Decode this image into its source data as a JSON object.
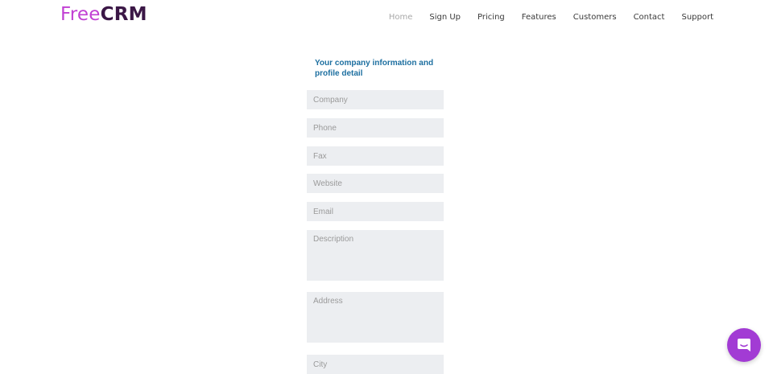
{
  "brand": {
    "part1": "Free",
    "part2": "CRM"
  },
  "nav": [
    {
      "label": "Home",
      "active": true
    },
    {
      "label": "Sign Up"
    },
    {
      "label": "Pricing"
    },
    {
      "label": "Features"
    },
    {
      "label": "Customers"
    },
    {
      "label": "Contact"
    },
    {
      "label": "Support"
    }
  ],
  "form": {
    "heading": "Your company information and profile detail",
    "company": {
      "placeholder": "Company",
      "value": ""
    },
    "phone": {
      "placeholder": "Phone",
      "value": ""
    },
    "fax": {
      "placeholder": "Fax",
      "value": ""
    },
    "website": {
      "placeholder": "Website",
      "value": ""
    },
    "email": {
      "placeholder": "Email",
      "value": ""
    },
    "description": {
      "placeholder": "Description",
      "value": ""
    },
    "address": {
      "placeholder": "Address",
      "value": ""
    },
    "city": {
      "placeholder": "City",
      "value": ""
    }
  },
  "chat": {
    "icon": "chat-icon"
  },
  "colors": {
    "brand_light": "#c13fd3",
    "brand_dark": "#3b1746",
    "heading": "#1d6fa0",
    "field_bg": "#eceef1",
    "chat_bg": "#a23bd4"
  }
}
